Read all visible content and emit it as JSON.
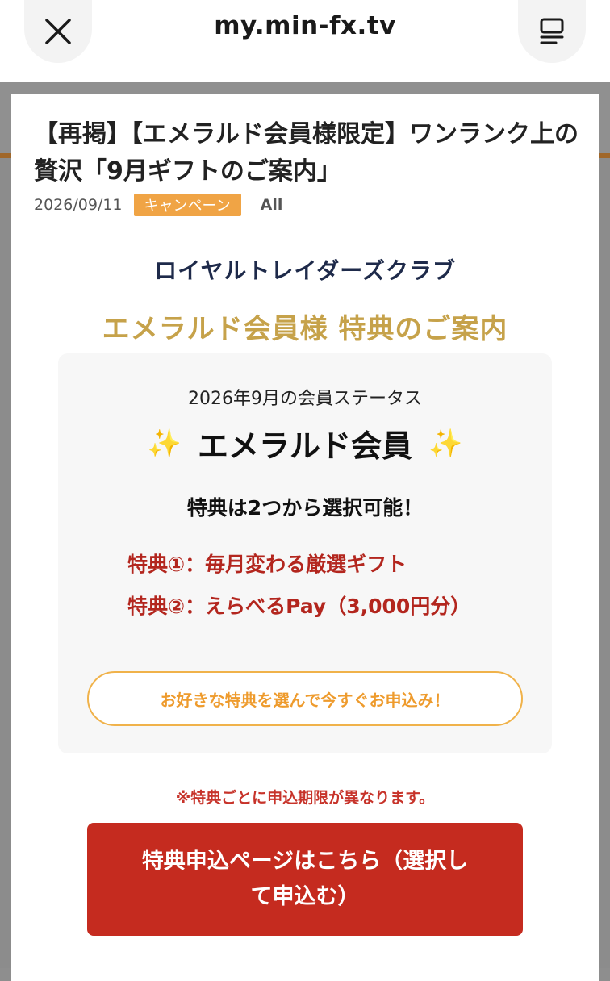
{
  "browser": {
    "url": "my.min-fx.tv",
    "close_icon": "close-icon",
    "menu_icon": "reader-menu-icon"
  },
  "post": {
    "title": "【再掲】【エメラルド会員様限定】ワンランク上の贅沢「9月ギフトのご案内」",
    "date": "2026/09/11",
    "badge": "キャンペーン",
    "category": "All"
  },
  "content": {
    "club_name": "ロイヤルトレイダーズクラブ",
    "club_subtitle": "エメラルド会員様 特典のご案内",
    "status_label": "2026年9月の会員ステータス",
    "status_value": "エメラルド会員",
    "sparkle_icon": "✨",
    "choose_text": "特典は2つから選択可能！",
    "benefit_1": "特典①：毎月変わる厳選ギフト",
    "benefit_2": "特典②：えらべるPay（3,000円分）",
    "cta_pill": "お好きな特典を選んで今すぐお申込み！",
    "note": "※特典ごとに申込期限が異なります。",
    "apply_button": "特典申込ページはこちら（選択して申込む）"
  },
  "colors": {
    "accent_gold": "#c6a24a",
    "badge_orange": "#f0a445",
    "benefit_red": "#b3261e",
    "button_red": "#c52b1f",
    "navy": "#1e2a4a"
  }
}
